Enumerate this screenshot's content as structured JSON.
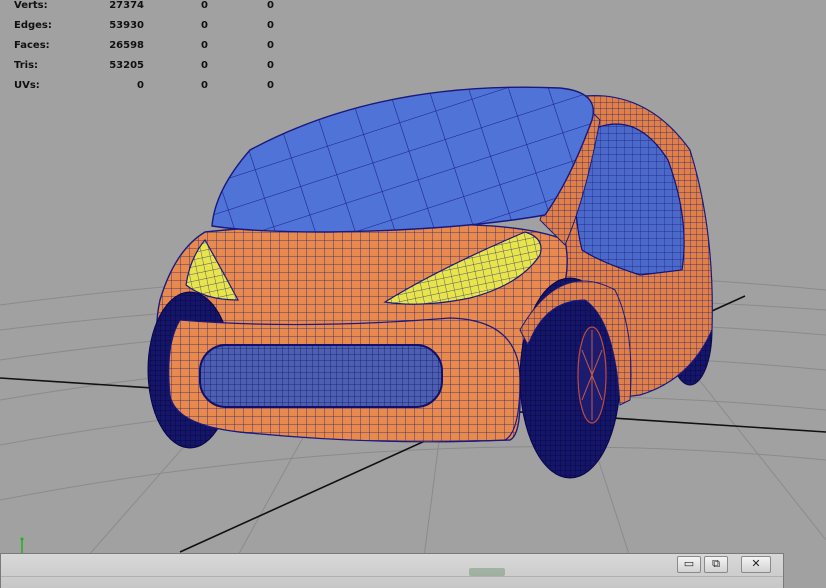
{
  "hud": {
    "rows": [
      {
        "label": "Verts:",
        "values": [
          "27374",
          "0",
          "0"
        ]
      },
      {
        "label": "Edges:",
        "values": [
          "53930",
          "0",
          "0"
        ]
      },
      {
        "label": "Faces:",
        "values": [
          "26598",
          "0",
          "0"
        ]
      },
      {
        "label": "Tris:",
        "values": [
          "53205",
          "0",
          "0"
        ]
      },
      {
        "label": "UVs:",
        "values": [
          "0",
          "0",
          "0"
        ]
      }
    ]
  },
  "window": {
    "minimize_glyph": "▭",
    "restore_glyph": "⧉",
    "close_glyph": "✕"
  },
  "icons": {
    "axis": "axis-gizmo-icon",
    "minimize": "minimize-icon",
    "restore": "restore-icon",
    "close": "close-icon"
  },
  "colors": {
    "viewport_bg": "#a1a1a1",
    "body_orange": "#e8894e",
    "glass_blue": "#4f73d6",
    "light_yellow": "#e6e24a",
    "wire_blue": "#1a1a8a",
    "tire_dark": "#11115a",
    "grid_line": "#8c8c8c"
  }
}
